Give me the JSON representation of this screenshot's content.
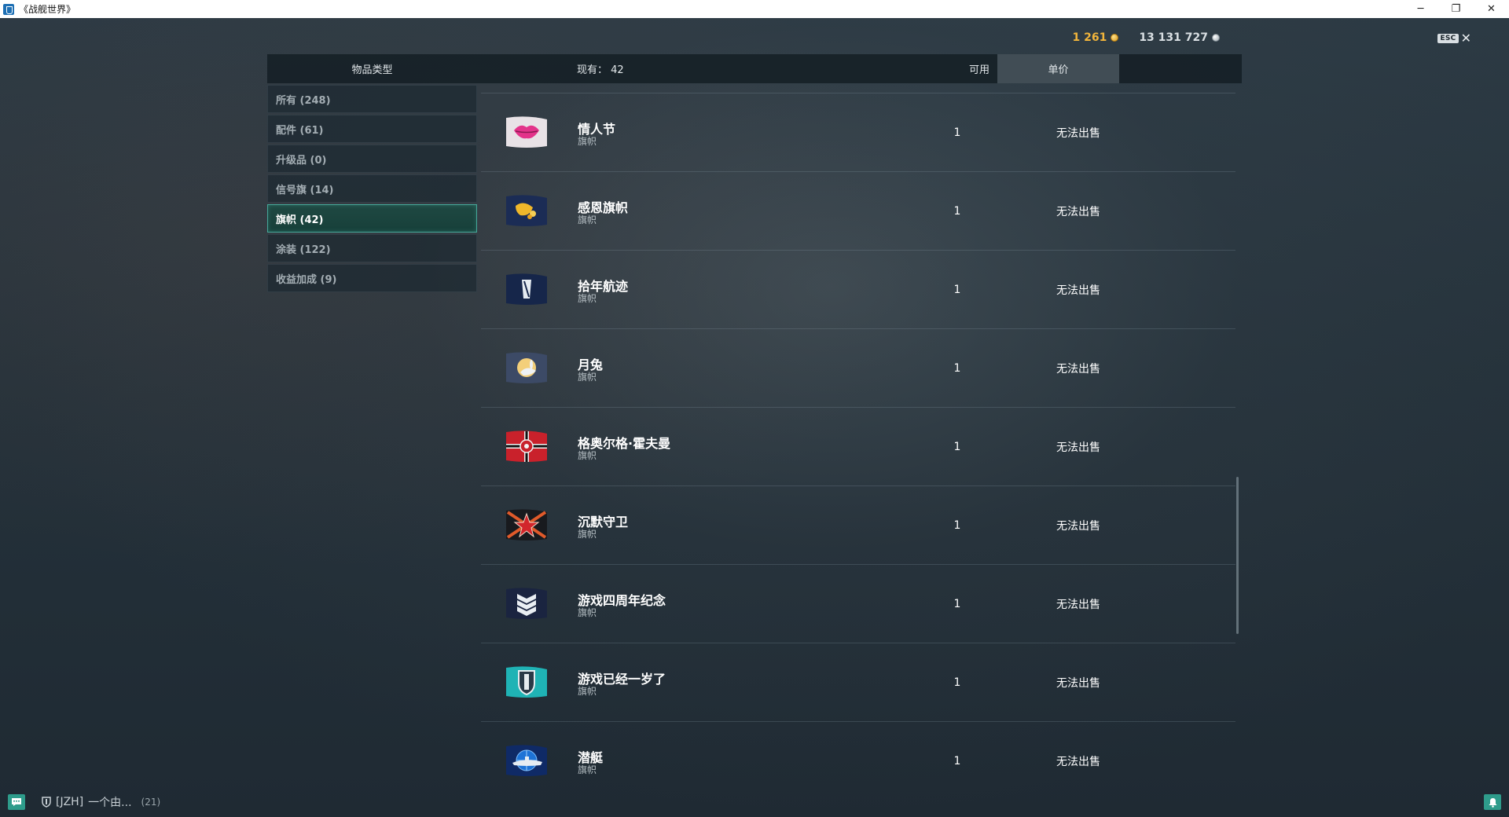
{
  "window": {
    "title": "《战舰世界》",
    "controls": {
      "minimize": "─",
      "restore": "❐",
      "close": "✕"
    }
  },
  "currency": {
    "gold": "1 261",
    "silver": "13 131 727"
  },
  "esc": {
    "key": "ESC",
    "close": "✕"
  },
  "header": {
    "category": "物品类型",
    "owned": "现有： 42",
    "available": "可用",
    "price": "单价"
  },
  "sidebar": {
    "items": [
      {
        "label": "所有 (248)"
      },
      {
        "label": "配件 (61)"
      },
      {
        "label": "升级品 (0)"
      },
      {
        "label": "信号旗 (14)"
      },
      {
        "label": "旗帜 (42)"
      },
      {
        "label": "涂装 (122)"
      },
      {
        "label": "收益加成 (9)"
      }
    ],
    "active_index": 4
  },
  "items": [
    {
      "name": "情人节",
      "type": "旗帜",
      "available": "1",
      "price": "无法出售",
      "icon": "valentine-lips-flag"
    },
    {
      "name": "感恩旗帜",
      "type": "旗帜",
      "available": "1",
      "price": "无法出售",
      "icon": "thanksgiving-cornucopia-flag"
    },
    {
      "name": "拾年航迹",
      "type": "旗帜",
      "available": "1",
      "price": "无法出售",
      "icon": "ten-years-wake-flag"
    },
    {
      "name": "月兔",
      "type": "旗帜",
      "available": "1",
      "price": "无法出售",
      "icon": "moon-rabbit-flag"
    },
    {
      "name": "格奥尔格·霍夫曼",
      "type": "旗帜",
      "available": "1",
      "price": "无法出售",
      "icon": "georg-hoffmann-flag"
    },
    {
      "name": "沉默守卫",
      "type": "旗帜",
      "available": "1",
      "price": "无法出售",
      "icon": "silent-guard-star-flag"
    },
    {
      "name": "游戏四周年纪念",
      "type": "旗帜",
      "available": "1",
      "price": "无法出售",
      "icon": "fourth-anniversary-flag"
    },
    {
      "name": "游戏已经一岁了",
      "type": "旗帜",
      "available": "1",
      "price": "无法出售",
      "icon": "first-anniversary-shield-flag"
    },
    {
      "name": "潜艇",
      "type": "旗帜",
      "available": "1",
      "price": "无法出售",
      "icon": "submarine-flag"
    }
  ],
  "bottom": {
    "clan": "[JZH]",
    "chat_preview": "一个由...",
    "count": "(21)"
  },
  "colors": {
    "gold": "#f2b53b",
    "accent_teal": "#46a89a",
    "panel": "#141e25"
  }
}
